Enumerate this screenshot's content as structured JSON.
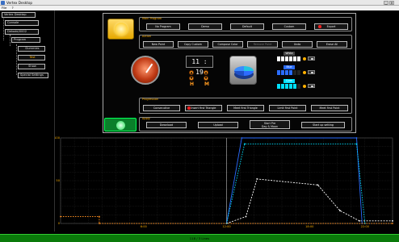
{
  "window": {
    "title": "Vertex Desktop",
    "menu": [
      "File",
      "?"
    ]
  },
  "tree": [
    {
      "label": "Vertex Desktop",
      "depth": 0
    },
    {
      "label": "Console",
      "depth": 1
    },
    {
      "label": "Dekode/0002",
      "depth": 1
    },
    {
      "label": "Program",
      "depth": 2
    },
    {
      "label": "Dummies",
      "depth": 3
    },
    {
      "label": "Test",
      "depth": 3
    },
    {
      "label": "Show",
      "depth": 3
    },
    {
      "label": "Special Settings",
      "depth": 3
    }
  ],
  "main_program": {
    "title": "Main Program",
    "buttons": [
      "No Program",
      "Demo",
      "Default",
      "Custom",
      "Export"
    ]
  },
  "action": {
    "title": "Action",
    "buttons": [
      "New Point",
      "Copy Custom",
      "Compose Color",
      "Remove Point",
      "Undo",
      "Erase All"
    ]
  },
  "clock": {
    "time": "11 : 19",
    "hours_label": "H",
    "minutes_label": "M"
  },
  "channels": [
    {
      "label": "White",
      "color": "#ffffff",
      "level": 1.0
    },
    {
      "label": "Blue",
      "color": "#2a6cff",
      "level": 0.6
    },
    {
      "label": "Cyan",
      "color": "#00e0ff",
      "level": 0.85
    }
  ],
  "progression": {
    "title": "Progression",
    "buttons": [
      "Consecutive",
      "Insert first Triangle",
      "Meet first Triangle",
      "Limit first Point",
      "Meet first Point"
    ]
  },
  "apply": {
    "title": "Apply",
    "buttons": [
      "Download",
      "Upload",
      "Start Pre\nDay & Moon",
      "Start up setting"
    ]
  },
  "status": {
    "text": "118 / 3 Lines"
  },
  "icons": {
    "logo": "sun-icon",
    "gauge": "gauge-icon",
    "pie": "pie-chart-icon",
    "green": "green-light-icon"
  },
  "chart_data": {
    "type": "line",
    "ylim": [
      0,
      100
    ],
    "y_ticks": [
      0,
      50,
      100
    ],
    "xlim": [
      0,
      24
    ],
    "x_ticks": [
      {
        "v": 6,
        "label": "6:00"
      },
      {
        "v": 12,
        "label": "12:00"
      },
      {
        "v": 18,
        "label": "18:00"
      },
      {
        "v": 22,
        "label": "22:00"
      }
    ],
    "cursor_x": 12,
    "series": [
      {
        "color": "#ffffff",
        "dash": "2,1.5",
        "points": [
          [
            12,
            0
          ],
          [
            13.4,
            8
          ],
          [
            14.2,
            52
          ],
          [
            18.6,
            45
          ],
          [
            20.2,
            15
          ],
          [
            21.6,
            3
          ],
          [
            24,
            3
          ]
        ]
      },
      {
        "color": "#2a6cff",
        "dash": "",
        "points": [
          [
            12,
            0
          ],
          [
            13.1,
            100
          ],
          [
            21.4,
            100
          ],
          [
            21.8,
            0
          ]
        ]
      },
      {
        "color": "#00e0ff",
        "dash": "1.5,1.5",
        "points": [
          [
            12,
            0
          ],
          [
            13.3,
            93
          ],
          [
            21.4,
            93
          ],
          [
            22,
            0
          ]
        ]
      },
      {
        "color": "#ff9020",
        "dash": "1.5,1.5",
        "points": [
          [
            0,
            8
          ],
          [
            2.8,
            8
          ],
          [
            2.8,
            0
          ],
          [
            24,
            0
          ]
        ]
      }
    ]
  }
}
